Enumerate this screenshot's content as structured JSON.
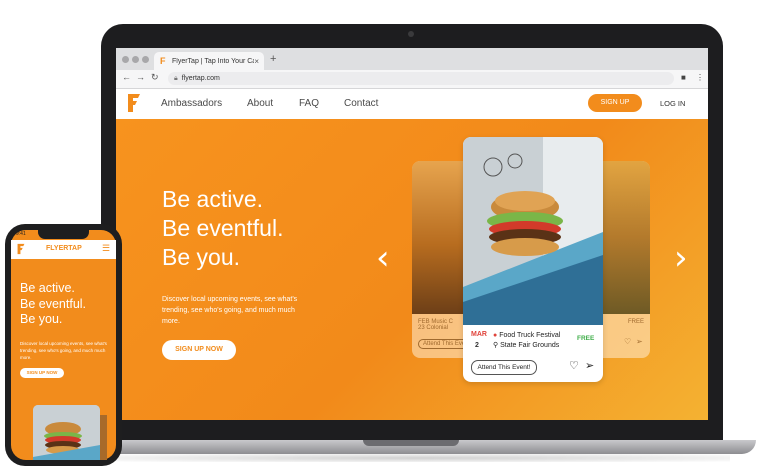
{
  "browser": {
    "tab_title": "FlyerTap | Tap Into Your Campus",
    "tab_close": "×",
    "new_tab": "+",
    "url": "flyertap.com"
  },
  "site_nav": {
    "links": [
      "Ambassadors",
      "About",
      "FAQ",
      "Contact"
    ],
    "signup": "SIGN UP",
    "login": "LOG IN"
  },
  "hero": {
    "headline": [
      "Be active.",
      "Be eventful.",
      "Be you."
    ],
    "subcopy": "Discover local upcoming events, see what's trending, see who's going, and much much more.",
    "cta": "SIGN UP NOW"
  },
  "cards": {
    "left": {
      "month": "FEB",
      "day": "23",
      "name": "Music C",
      "place": "Colonial",
      "attend": "Attend This Event"
    },
    "main": {
      "month": "MAR",
      "day": "2",
      "name": "Food Truck Festival",
      "place": "State Fair Grounds",
      "price": "FREE",
      "attend": "Attend This Event!"
    },
    "right": {
      "price": "FREE"
    }
  },
  "phone": {
    "status_time": "9:41",
    "brand": "FLYERTAP",
    "headline": [
      "Be active.",
      "Be eventful.",
      "Be you."
    ],
    "subcopy": "Discover local upcoming events, see what's trending, see who's going, and much much more.",
    "cta": "SIGN UP NOW"
  },
  "colors": {
    "brand": "#f28c1c",
    "free": "#3fae49",
    "month": "#e0443c"
  },
  "icons": [
    "menu-icon",
    "heart-icon",
    "send-icon",
    "pin-icon",
    "chevron-left-icon",
    "chevron-right-icon"
  ]
}
